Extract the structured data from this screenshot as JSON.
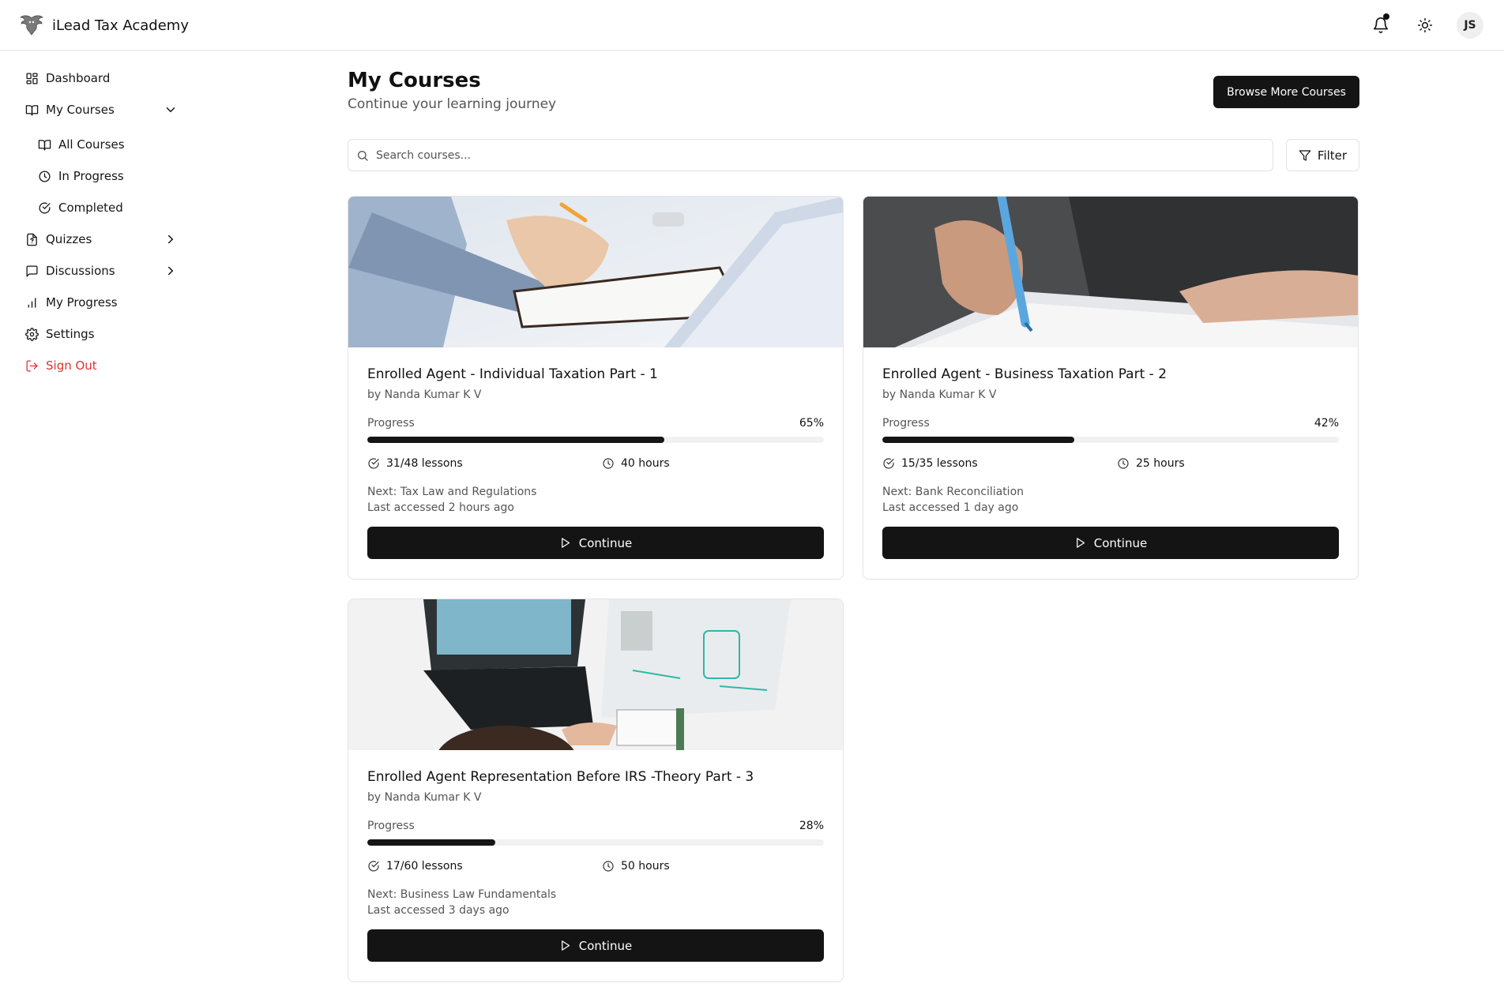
{
  "app": {
    "brand_name": "iLead Tax Academy",
    "user_initials": "JS"
  },
  "sidebar": {
    "dashboard": "Dashboard",
    "my_courses": "My Courses",
    "all_courses": "All Courses",
    "in_progress": "In Progress",
    "completed": "Completed",
    "quizzes": "Quizzes",
    "discussions": "Discussions",
    "my_progress": "My Progress",
    "settings": "Settings",
    "sign_out": "Sign Out"
  },
  "header": {
    "title": "My Courses",
    "subtitle": "Continue your learning journey",
    "browse_label": "Browse More Courses"
  },
  "search": {
    "placeholder": "Search courses...",
    "filter_label": "Filter"
  },
  "courses": [
    {
      "title": "Enrolled Agent - Individual Taxation Part - 1",
      "author": "by Nanda Kumar K V",
      "progress_label": "Progress",
      "progress_text": "65%",
      "progress": 0.65,
      "lessons": "31/48 lessons",
      "hours": "40 hours",
      "next": "Next: Tax Law and Regulations",
      "last_accessed": "Last accessed 2 hours ago",
      "button": "Continue"
    },
    {
      "title": "Enrolled Agent - Business Taxation Part - 2",
      "author": "by Nanda Kumar K V",
      "progress_label": "Progress",
      "progress_text": "42%",
      "progress": 0.42,
      "lessons": "15/35 lessons",
      "hours": "25 hours",
      "next": "Next: Bank Reconciliation",
      "last_accessed": "Last accessed 1 day ago",
      "button": "Continue"
    },
    {
      "title": "Enrolled Agent Representation Before IRS -Theory Part - 3",
      "author": "by Nanda Kumar K V",
      "progress_label": "Progress",
      "progress_text": "28%",
      "progress": 0.28,
      "lessons": "17/60 lessons",
      "hours": "50 hours",
      "next": "Next: Business Law Fundamentals",
      "last_accessed": "Last accessed 3 days ago",
      "button": "Continue"
    }
  ],
  "colors": {
    "accent": "#141414",
    "danger": "#e03131",
    "muted": "#555555"
  }
}
